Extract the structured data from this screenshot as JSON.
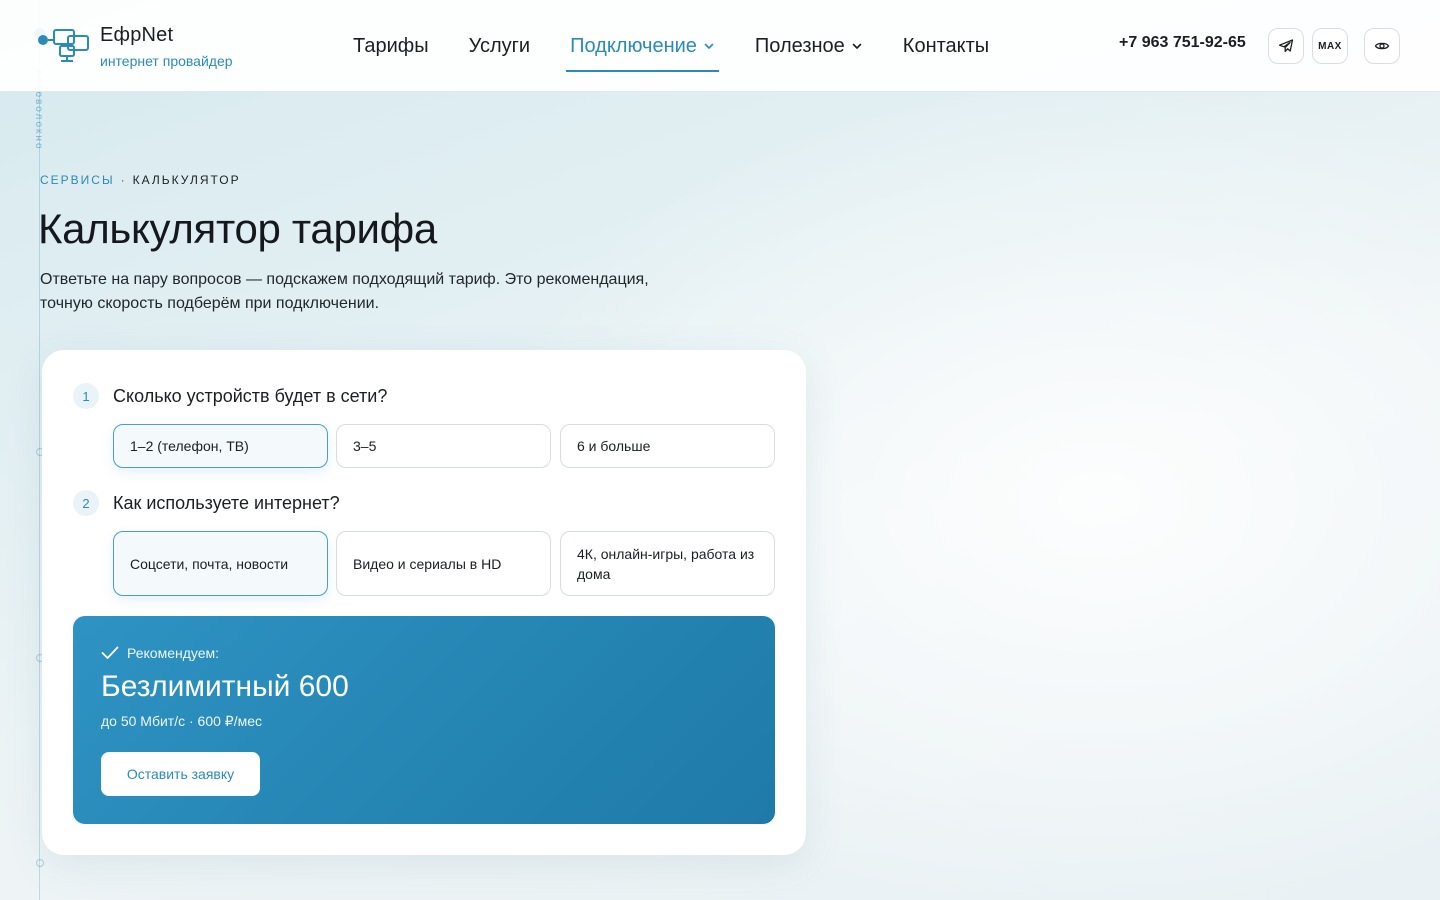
{
  "brand": {
    "name": "ЕфрNet",
    "tagline": "интернет провайдер"
  },
  "nav": {
    "items": [
      {
        "label": "Тарифы",
        "active": false,
        "dropdown": false
      },
      {
        "label": "Услуги",
        "active": false,
        "dropdown": false
      },
      {
        "label": "Подключение",
        "active": true,
        "dropdown": true
      },
      {
        "label": "Полезное",
        "active": false,
        "dropdown": true
      },
      {
        "label": "Контакты",
        "active": false,
        "dropdown": false
      }
    ]
  },
  "header": {
    "phone": "+7 963 751-92-65",
    "telegram_icon": "telegram-icon",
    "max_label": "MAX",
    "accessibility_icon": "eye-icon"
  },
  "decor": {
    "vertical_text": "оптоволокно"
  },
  "breadcrumb": {
    "parent": "СЕРВИСЫ",
    "separator": "·",
    "current": "КАЛЬКУЛЯТОР"
  },
  "page": {
    "title": "Калькулятор тарифа",
    "lead": "Ответьте на пару вопросов — подскажем подходящий тариф. Это рекомендация, точную скорость подберём при подключении."
  },
  "questions": [
    {
      "number": "1",
      "text": "Сколько устройств будет в сети?",
      "options": [
        "1–2 (телефон, ТВ)",
        "3–5",
        "6 и больше"
      ],
      "selected": 0
    },
    {
      "number": "2",
      "text": "Как используете интернет?",
      "options": [
        "Соцсети, почта, новости",
        "Видео и сериалы в HD",
        "4К, онлайн-игры, работа из дома"
      ],
      "selected": 0
    }
  ],
  "result": {
    "label": "Рекомендуем:",
    "plan": "Безлимитный 600",
    "details": "до 50 Мбит/с · 600 ₽/мес",
    "cta": "Оставить заявку"
  },
  "colors": {
    "accent": "#2a8bb8",
    "result_bg": "#2585b3",
    "text": "#1b1f23"
  }
}
